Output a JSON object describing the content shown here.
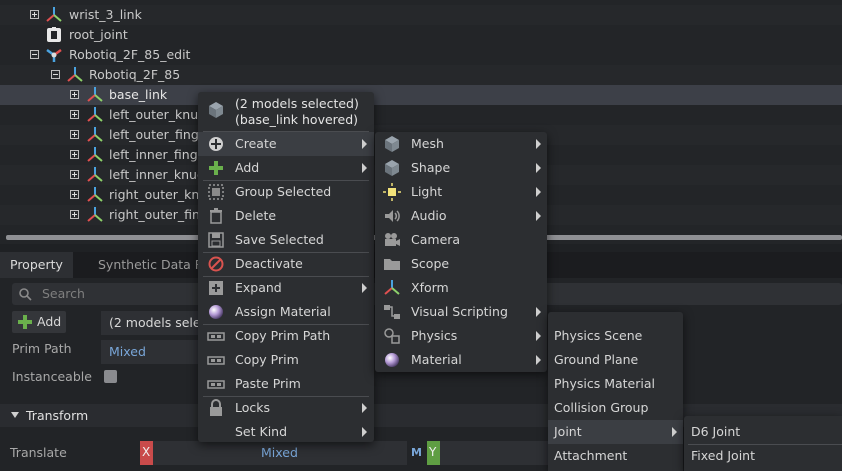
{
  "stage": {
    "rows": [
      {
        "label": "wrist_3_link"
      },
      {
        "label": "root_joint"
      },
      {
        "label": "Robotiq_2F_85_edit"
      },
      {
        "label": "Robotiq_2F_85"
      },
      {
        "label": "base_link"
      },
      {
        "label": "left_outer_knuc"
      },
      {
        "label": "left_outer_finge"
      },
      {
        "label": "left_inner_finge"
      },
      {
        "label": "left_inner_knuc"
      },
      {
        "label": "right_outer_knu"
      },
      {
        "label": "right_outer_fing"
      }
    ]
  },
  "property": {
    "tabs": [
      "Property",
      "Synthetic Data Re"
    ],
    "search_placeholder": "Search",
    "add_label": "Add",
    "models_selected": "(2 models selec",
    "prim_path_label": "Prim Path",
    "prim_path_value": "Mixed",
    "instanceable_label": "Instanceable",
    "transform_label": "Transform",
    "translate_label": "Translate",
    "x_label": "X",
    "translate_value": "Mixed",
    "m_label": "M",
    "y_label": "Y"
  },
  "context_menu": {
    "header_line1": "(2 models selected)",
    "header_line2": "(base_link hovered)",
    "items": [
      {
        "label": "Create",
        "icon": "plus-circle-icon",
        "submenu": true
      },
      {
        "label": "Add",
        "icon": "green-plus-icon",
        "submenu": true
      },
      {
        "label": "Group Selected",
        "icon": "group-icon",
        "submenu": false
      },
      {
        "label": "Delete",
        "icon": "trash-icon",
        "submenu": false
      },
      {
        "label": "Save Selected",
        "icon": "save-icon",
        "submenu": false
      },
      {
        "label": "Deactivate",
        "icon": "deactivate-icon",
        "submenu": false
      },
      {
        "label": "Expand",
        "icon": "expand-icon",
        "submenu": true
      },
      {
        "label": "Assign Material",
        "icon": "material-sphere-icon",
        "submenu": false
      },
      {
        "label": "Copy Prim Path",
        "icon": "copy-path-icon",
        "submenu": false
      },
      {
        "label": "Copy Prim",
        "icon": "copy-prim-icon",
        "submenu": false
      },
      {
        "label": "Paste Prim",
        "icon": "paste-prim-icon",
        "submenu": false
      },
      {
        "label": "Locks",
        "icon": "lock-icon",
        "submenu": true
      },
      {
        "label": "Set Kind",
        "icon": "",
        "submenu": true
      }
    ]
  },
  "create_menu": {
    "items": [
      {
        "label": "Mesh",
        "icon": "mesh-icon",
        "submenu": true
      },
      {
        "label": "Shape",
        "icon": "shape-icon",
        "submenu": true
      },
      {
        "label": "Light",
        "icon": "light-icon",
        "submenu": true
      },
      {
        "label": "Audio",
        "icon": "audio-icon",
        "submenu": true
      },
      {
        "label": "Camera",
        "icon": "camera-icon",
        "submenu": false
      },
      {
        "label": "Scope",
        "icon": "folder-icon",
        "submenu": false
      },
      {
        "label": "Xform",
        "icon": "xform-icon",
        "submenu": false
      },
      {
        "label": "Visual Scripting",
        "icon": "graph-icon",
        "submenu": true
      },
      {
        "label": "Physics",
        "icon": "physics-icon",
        "submenu": true
      },
      {
        "label": "Material",
        "icon": "material-sphere-icon",
        "submenu": true
      }
    ]
  },
  "physics_menu": {
    "items": [
      "Physics Scene",
      "Ground Plane",
      "Physics Material",
      "Collision Group",
      "Joint",
      "Attachment"
    ]
  },
  "joint_menu": {
    "items": [
      "D6 Joint",
      "Fixed Joint"
    ]
  },
  "colors": {
    "background": "#1f2124",
    "menu": "#2c2e31",
    "selection": "#3d4048",
    "accent_blue": "#79a6d8",
    "x_red": "#c94b4b",
    "y_green": "#5f9e43"
  }
}
